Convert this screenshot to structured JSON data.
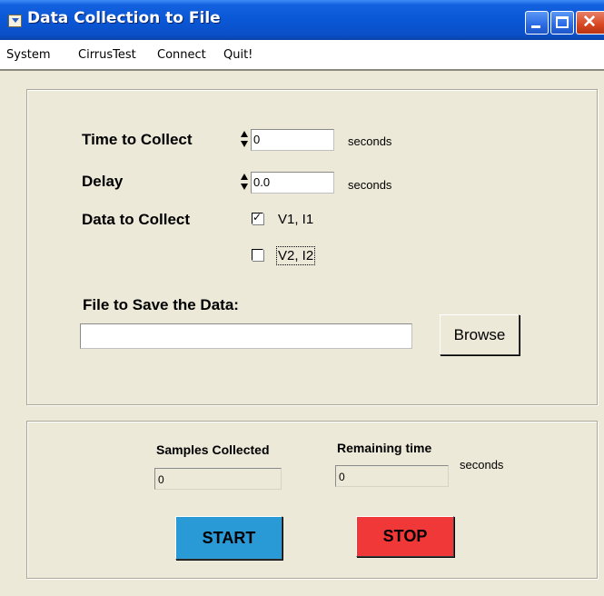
{
  "window": {
    "title": "Data Collection to File",
    "buttons": {
      "minimize_icon": "minimize-icon",
      "maximize_icon": "maximize-icon",
      "close_glyph": "✕"
    }
  },
  "menu": [
    "System",
    "CirrusTest",
    "Connect",
    "Quit!"
  ],
  "settings": {
    "time_label": "Time to Collect",
    "time_value": "0",
    "time_unit": "seconds",
    "delay_label": "Delay",
    "delay_value": "0.0",
    "delay_unit": "seconds",
    "data_label": "Data to Collect",
    "channels": [
      {
        "label": "V1, I1",
        "checked": true
      },
      {
        "label": "V2, I2",
        "checked": false
      }
    ],
    "file_label": "File to Save the Data:",
    "file_value": "",
    "browse_label": "Browse"
  },
  "status": {
    "samples_label": "Samples Collected",
    "samples_value": "0",
    "remaining_label": "Remaining time",
    "remaining_value": "0",
    "remaining_unit": "seconds",
    "start_label": "START",
    "stop_label": "STOP"
  },
  "colors": {
    "start": "#2a9ad6",
    "stop": "#f03838",
    "titlebar": "#0a57d6"
  }
}
